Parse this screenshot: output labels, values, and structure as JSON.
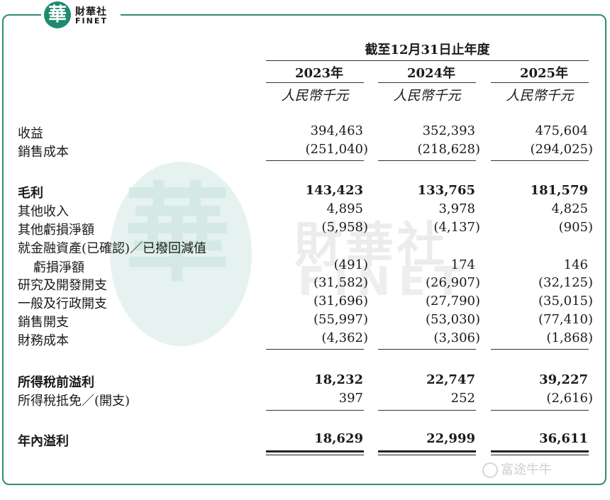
{
  "logo": {
    "glyph": "華",
    "cn": "財華社",
    "en": "FINET"
  },
  "watermark": {
    "glyph": "華",
    "cn": "財華社",
    "en": "FINET"
  },
  "header": {
    "period": "截至12月31日止年度",
    "years": [
      "2023年",
      "2024年",
      "2025年"
    ],
    "unit": "人民幣千元"
  },
  "rows": [
    {
      "label": "收益",
      "values": [
        "394,463",
        "352,393",
        "475,604"
      ]
    },
    {
      "label": "銷售成本",
      "values": [
        "(251,040)",
        "(218,628)",
        "(294,025)"
      ]
    },
    {
      "label": "毛利",
      "values": [
        "143,423",
        "133,765",
        "181,579"
      ]
    },
    {
      "label": "其他收入",
      "values": [
        "4,895",
        "3,978",
        "4,825"
      ]
    },
    {
      "label": "其他虧損淨額",
      "values": [
        "(5,958)",
        "(4,137)",
        "(905)"
      ]
    },
    {
      "label": "就金融資產(已確認)／已撥回減值",
      "values": []
    },
    {
      "label": "虧損淨額",
      "values": [
        "(491)",
        "174",
        "146"
      ]
    },
    {
      "label": "研究及開發開支",
      "values": [
        "(31,582)",
        "(26,907)",
        "(32,125)"
      ]
    },
    {
      "label": "一般及行政開支",
      "values": [
        "(31,696)",
        "(27,790)",
        "(35,015)"
      ]
    },
    {
      "label": "銷售開支",
      "values": [
        "(55,997)",
        "(53,030)",
        "(77,410)"
      ]
    },
    {
      "label": "財務成本",
      "values": [
        "(4,362)",
        "(3,306)",
        "(1,868)"
      ]
    },
    {
      "label": "所得稅前溢利",
      "values": [
        "18,232",
        "22,747",
        "39,227"
      ]
    },
    {
      "label": "所得稅抵免／(開支)",
      "values": [
        "397",
        "252",
        "(2,616)"
      ]
    },
    {
      "label": "年內溢利",
      "values": [
        "18,629",
        "22,999",
        "36,611"
      ]
    }
  ],
  "footer": {
    "brand": "富途牛牛"
  }
}
